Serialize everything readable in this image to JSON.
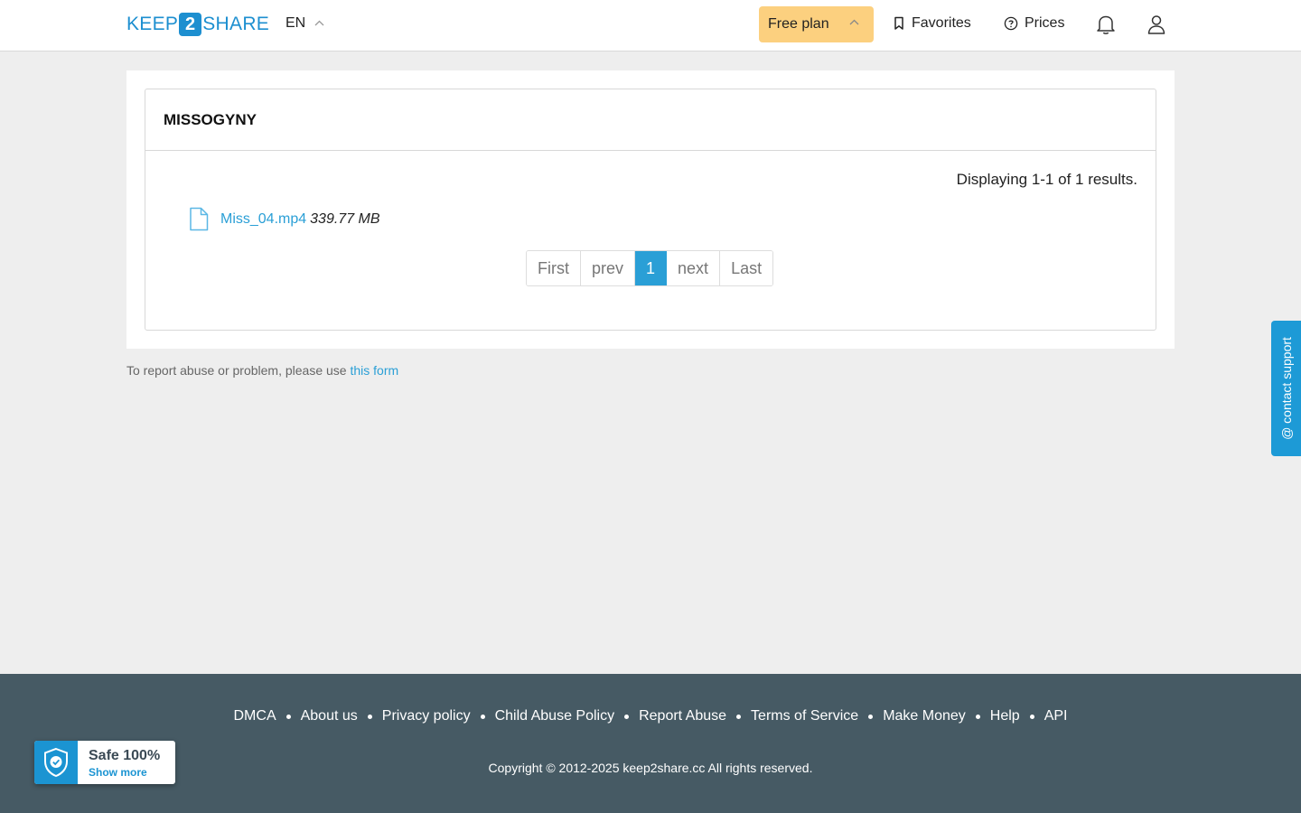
{
  "header": {
    "logo": {
      "left": "KEEP",
      "middle": "2",
      "right": "SHARE"
    },
    "language": "EN",
    "plan_label": "Free plan",
    "favorites_label": "Favorites",
    "prices_label": "Prices"
  },
  "folder": {
    "title": "MISSOGYNY",
    "summary": "Displaying 1-1 of 1 results.",
    "files": [
      {
        "name": "Miss_04.mp4",
        "size": "339.77 MB"
      }
    ],
    "pagination": {
      "first": "First",
      "prev": "prev",
      "current": "1",
      "next": "next",
      "last": "Last"
    }
  },
  "report": {
    "text": "To report abuse or problem, please use",
    "link": "this form"
  },
  "support_label": "@ contact support",
  "footer": {
    "links": [
      "DMCA",
      "About us",
      "Privacy policy",
      "Child Abuse Policy",
      "Report Abuse",
      "Terms of Service",
      "Make Money",
      "Help",
      "API"
    ],
    "copyright": "Copyright © 2012-2025 keep2share.cc All rights reserved."
  },
  "safe_badge": {
    "title": "Safe 100%",
    "subtitle": "Show more"
  },
  "colors": {
    "accent": "#2a9fd6",
    "plan": "#fcd07f",
    "footer": "#465a64",
    "background": "#eeeeee"
  }
}
